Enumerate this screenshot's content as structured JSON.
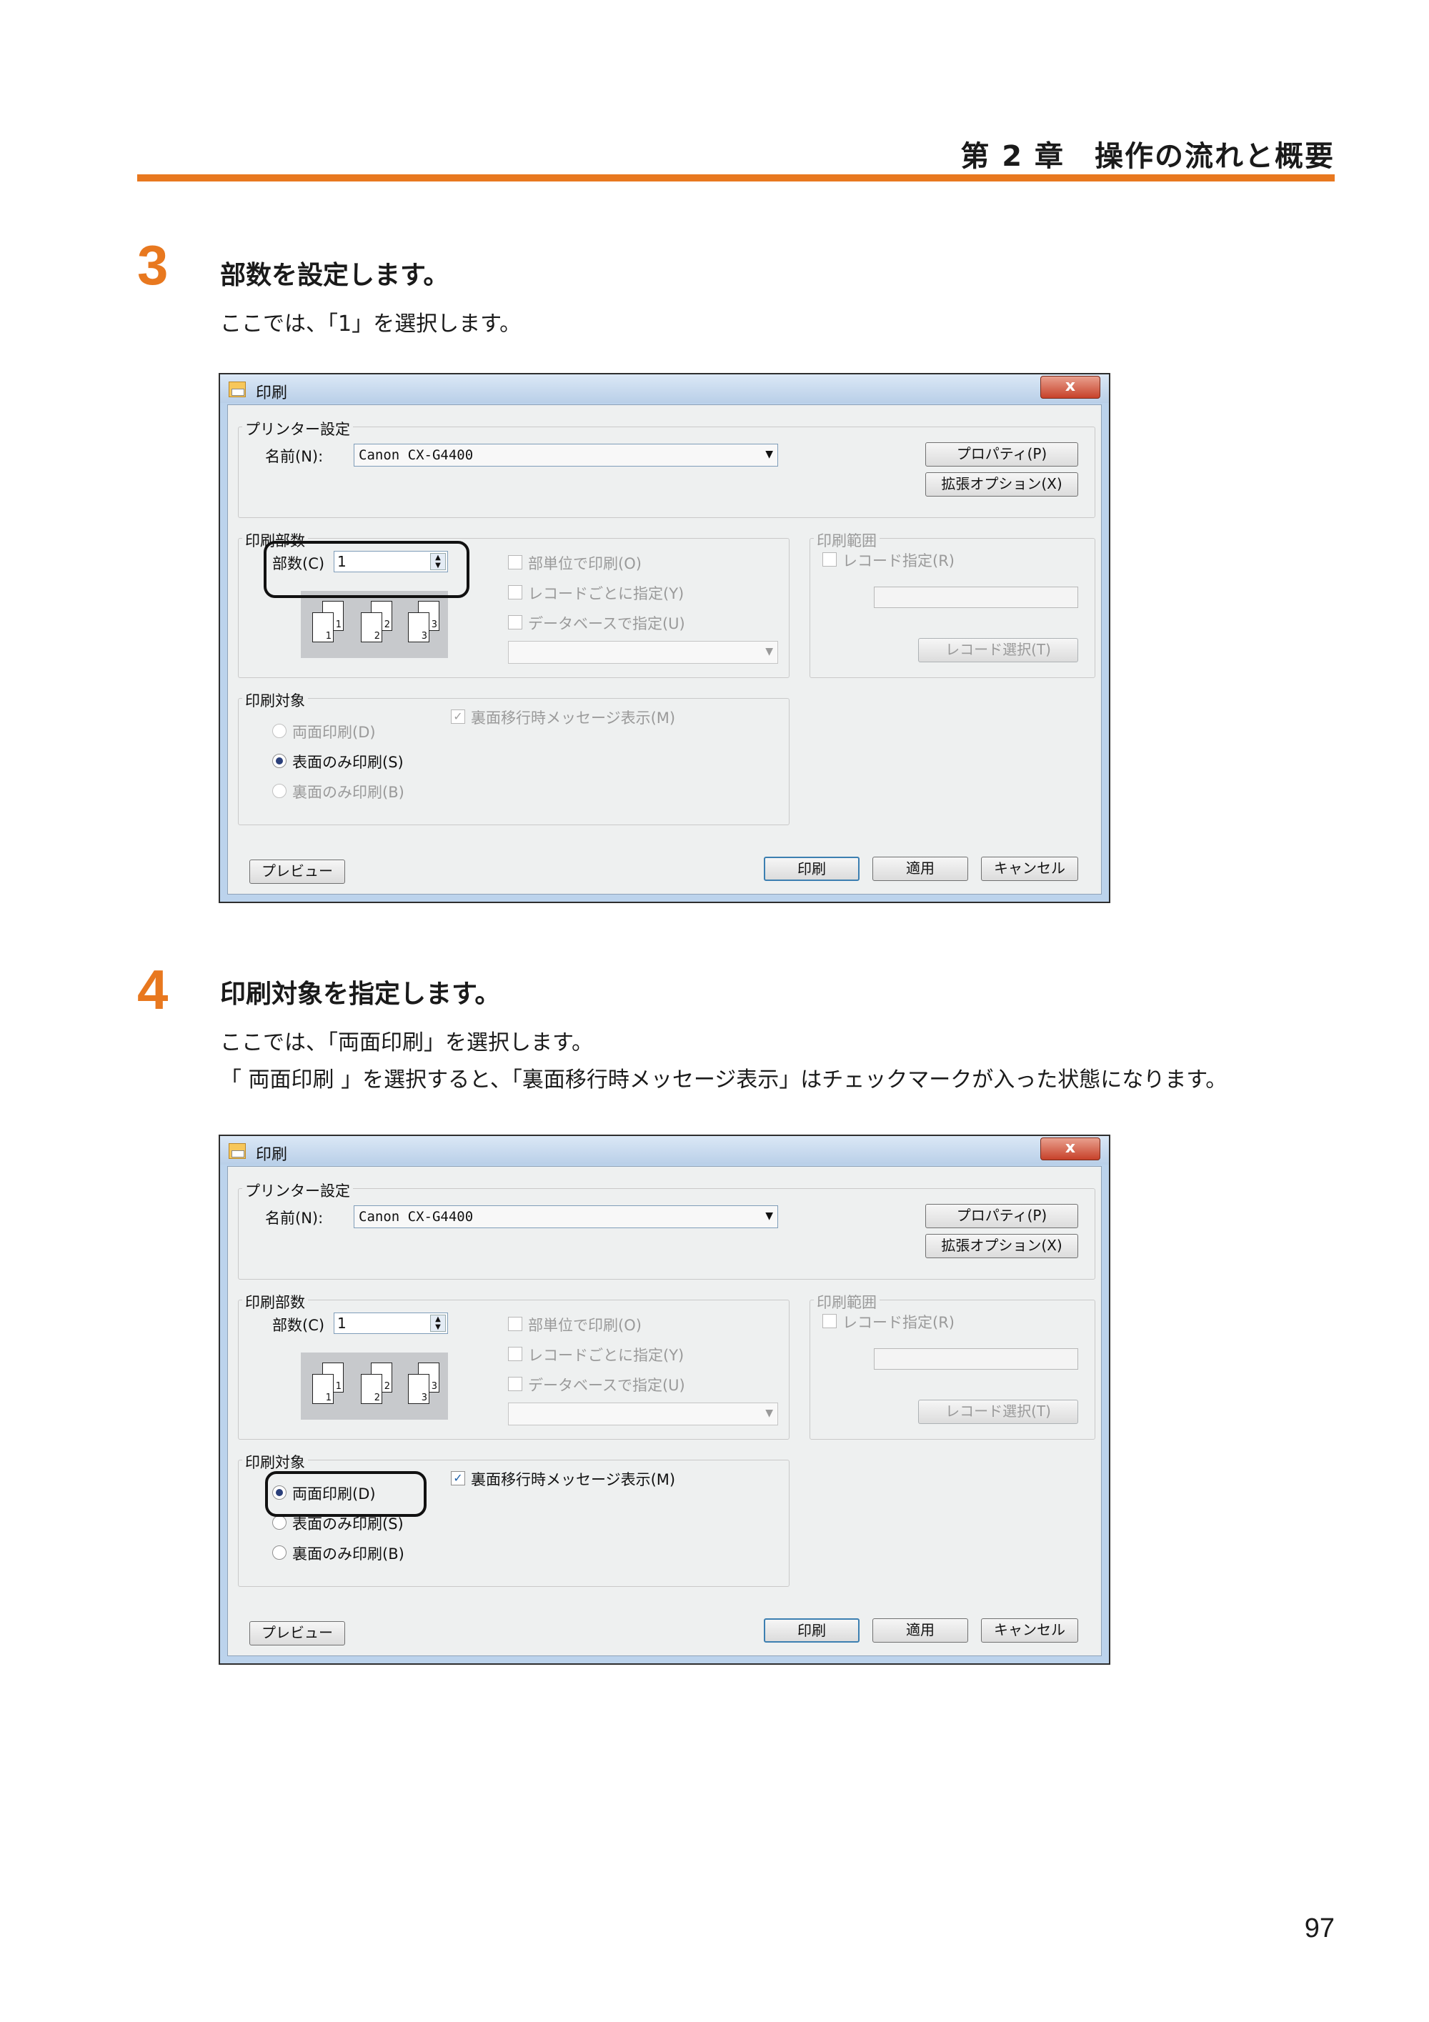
{
  "header": {
    "title": "第 2 章　操作の流れと概要"
  },
  "page_number": "97",
  "steps": [
    {
      "number": "3",
      "title": "部数を設定します。",
      "lines": [
        "ここでは、「1」を選択します。"
      ]
    },
    {
      "number": "4",
      "title": "印刷対象を指定します。",
      "lines": [
        "ここでは、「両面印刷」を選択します。",
        "「 両面印刷 」を選択すると、「裏面移行時メッセージ表示」はチェックマークが入った状態になります。"
      ]
    }
  ],
  "dialog": {
    "title": "印刷",
    "close": "x",
    "printer_group": "プリンター設定",
    "name_label": "名前(N):",
    "printer_name": "Canon CX-G4400",
    "properties_button": "プロパティ(P)",
    "ext_options_button": "拡張オプション(X)",
    "copies_group": "印刷部数",
    "copies_label": "部数(C)",
    "copies_value": "1",
    "collate_pages": [
      "1",
      "2",
      "3"
    ],
    "opt_per_copy": "部単位で印刷(O)",
    "opt_per_record": "レコードごとに指定(Y)",
    "opt_database": "データベースで指定(U)",
    "range_group": "印刷範囲",
    "record_specify": "レコード指定(R)",
    "record_select_button": "レコード選択(T)",
    "target_group": "印刷対象",
    "duplex": "両面印刷(D)",
    "front_only": "表面のみ印刷(S)",
    "back_only": "裏面のみ印刷(B)",
    "back_message": "裏面移行時メッセージ表示(M)",
    "preview_button": "プレビュー",
    "print_button": "印刷",
    "apply_button": "適用",
    "cancel_button": "キャンセル"
  },
  "dialog_states": [
    {
      "selected_target": "front_only",
      "duplex_enabled": false,
      "back_only_enabled": false,
      "message_checked": true,
      "message_enabled": false,
      "highlight": "copies"
    },
    {
      "selected_target": "duplex",
      "duplex_enabled": true,
      "back_only_enabled": true,
      "message_checked": true,
      "message_enabled": true,
      "highlight": "duplex"
    }
  ]
}
